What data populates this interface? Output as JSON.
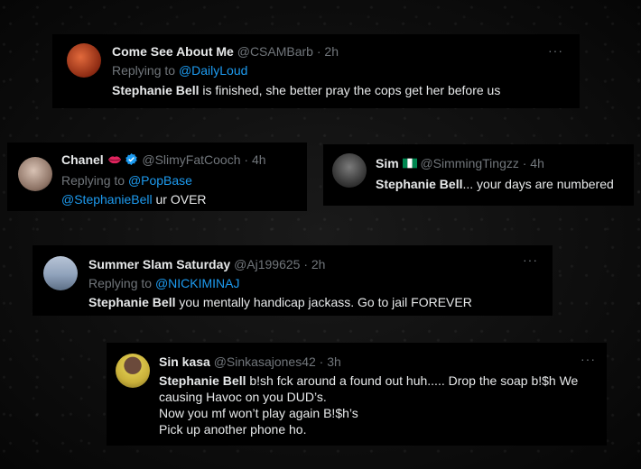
{
  "tweets": [
    {
      "name": "Come See About Me",
      "handle": "@CSAMBarb",
      "time": "· 2h",
      "replying_prefix": "Replying to ",
      "replying_to": "@DailyLoud",
      "bold_lead": "Stephanie Bell",
      "text": " is finished, she better pray the cops get her before us",
      "more": "···"
    },
    {
      "name": "Chanel",
      "handle": "@SlimyFatCooch",
      "time": "· 4h",
      "replying_prefix": "Replying to ",
      "replying_to": "@PopBase",
      "mention": "@StephanieBell",
      "text": " ur OVER"
    },
    {
      "name": "Sim",
      "handle": "@SimmingTingzz",
      "time": "· 4h",
      "bold_lead": "Stephanie Bell",
      "text": "... your days are numbered"
    },
    {
      "name": "Summer Slam Saturday",
      "handle": "@Aj199625",
      "time": "· 2h",
      "replying_prefix": "Replying to ",
      "replying_to": "@NICKIMINAJ",
      "bold_lead": "Stephanie Bell",
      "text": " you mentally handicap jackass. Go to jail FOREVER",
      "more": "···"
    },
    {
      "name": "Sin kasa",
      "handle": "@Sinkasajones42",
      "time": "· 3h",
      "bold_lead": "Stephanie Bell",
      "line1": " b!sh  fck around a found out huh..... Drop the soap b!$h We",
      "line2": "causing Havoc on you DUD’s.",
      "line3": "Now you mf won’t play again B!$h’s",
      "line4": "Pick up another phone ho.",
      "more": "···"
    }
  ],
  "colors": {
    "link": "#1d9bf0",
    "muted": "#71767b",
    "text": "#e7e9ea",
    "verified": "#1d9bf0"
  }
}
